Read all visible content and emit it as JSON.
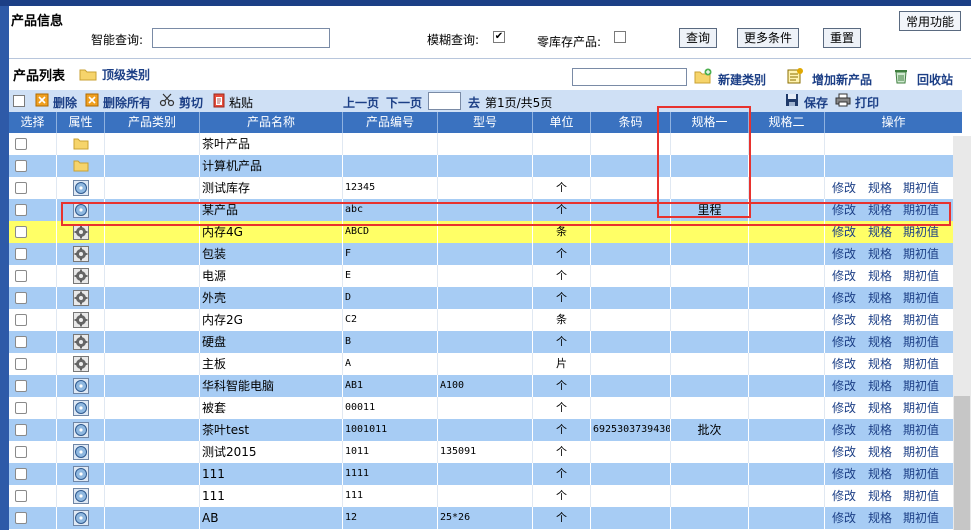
{
  "app": {
    "page_title": "产品信息",
    "common_functions": "常用功能"
  },
  "search": {
    "smart_label": "智能查询:",
    "smart_value": "",
    "fuzzy_label": "模糊查询:",
    "fuzzy_checked": "✔",
    "zero_stock_label": "零库存产品:",
    "query_button": "查询",
    "more_button": "更多条件",
    "reset_button": "重置"
  },
  "list": {
    "title": "产品列表",
    "top_category": "顶级类别",
    "new_category": "新建类别",
    "add_product": "增加新产品",
    "recycle_bin": "回收站",
    "search_value": ""
  },
  "toolbar": {
    "delete": "删除",
    "delete_all": "删除所有",
    "cut": "剪切",
    "paste": "粘贴",
    "prev_page": "上一页",
    "next_page": "下一页",
    "go_to": "去",
    "page_info": "第1页/共5页",
    "save": "保存",
    "print": "打印"
  },
  "table": {
    "headers": [
      "选择",
      "属性",
      "产品类别",
      "产品名称",
      "产品编号",
      "型号",
      "单位",
      "条码",
      "规格一",
      "规格二",
      "操作"
    ],
    "actions": {
      "edit": "修改",
      "spec": "规格",
      "initial": "期初值"
    },
    "rows": [
      {
        "type": "folder",
        "name": "茶叶产品",
        "code": "",
        "model": "",
        "unit": "",
        "barcode": "",
        "spec1": "",
        "spec2": "",
        "style": "white",
        "actions": false
      },
      {
        "type": "folder",
        "name": "计算机产品",
        "code": "",
        "model": "",
        "unit": "",
        "barcode": "",
        "spec1": "",
        "spec2": "",
        "style": "blue",
        "actions": false
      },
      {
        "type": "disc",
        "name": "测试库存",
        "code": "12345",
        "model": "",
        "unit": "个",
        "barcode": "",
        "spec1": "",
        "spec2": "",
        "style": "white",
        "actions": true
      },
      {
        "type": "disc",
        "name": "某产品",
        "code": "abc",
        "model": "",
        "unit": "个",
        "barcode": "",
        "spec1": "里程",
        "spec2": "",
        "style": "blue",
        "actions": true
      },
      {
        "type": "gear",
        "name": "内存4G",
        "code": "ABCD",
        "model": "",
        "unit": "条",
        "barcode": "",
        "spec1": "",
        "spec2": "",
        "style": "hl",
        "actions": true
      },
      {
        "type": "gear",
        "name": "包装",
        "code": "F",
        "model": "",
        "unit": "个",
        "barcode": "",
        "spec1": "",
        "spec2": "",
        "style": "blue",
        "actions": true
      },
      {
        "type": "gear",
        "name": "电源",
        "code": "E",
        "model": "",
        "unit": "个",
        "barcode": "",
        "spec1": "",
        "spec2": "",
        "style": "white",
        "actions": true
      },
      {
        "type": "gear",
        "name": "外壳",
        "code": "D",
        "model": "",
        "unit": "个",
        "barcode": "",
        "spec1": "",
        "spec2": "",
        "style": "blue",
        "actions": true
      },
      {
        "type": "gear",
        "name": "内存2G",
        "code": "C2",
        "model": "",
        "unit": "条",
        "barcode": "",
        "spec1": "",
        "spec2": "",
        "style": "white",
        "actions": true
      },
      {
        "type": "gear",
        "name": "硬盘",
        "code": "B",
        "model": "",
        "unit": "个",
        "barcode": "",
        "spec1": "",
        "spec2": "",
        "style": "blue",
        "actions": true
      },
      {
        "type": "gear",
        "name": "主板",
        "code": "A",
        "model": "",
        "unit": "片",
        "barcode": "",
        "spec1": "",
        "spec2": "",
        "style": "white",
        "actions": true
      },
      {
        "type": "disc",
        "name": "华科智能电脑",
        "code": "AB1",
        "model": "A100",
        "unit": "个",
        "barcode": "",
        "spec1": "",
        "spec2": "",
        "style": "blue",
        "actions": true
      },
      {
        "type": "disc",
        "name": "被套",
        "code": "00011",
        "model": "",
        "unit": "个",
        "barcode": "",
        "spec1": "",
        "spec2": "",
        "style": "white",
        "actions": true
      },
      {
        "type": "disc",
        "name": "茶叶test",
        "code": "1001011",
        "model": "",
        "unit": "个",
        "barcode": "6925303739430",
        "spec1": "批次",
        "spec2": "",
        "style": "blue",
        "actions": true
      },
      {
        "type": "disc",
        "name": "测试2015",
        "code": "1011",
        "model": "135091",
        "unit": "个",
        "barcode": "",
        "spec1": "",
        "spec2": "",
        "style": "white",
        "actions": true
      },
      {
        "type": "disc",
        "name": "111",
        "code": "1111",
        "model": "",
        "unit": "个",
        "barcode": "",
        "spec1": "",
        "spec2": "",
        "style": "blue",
        "actions": true
      },
      {
        "type": "disc",
        "name": "111",
        "code": "111",
        "model": "",
        "unit": "个",
        "barcode": "",
        "spec1": "",
        "spec2": "",
        "style": "white",
        "actions": true
      },
      {
        "type": "disc",
        "name": "AB",
        "code": "12",
        "model": "25*26",
        "unit": "个",
        "barcode": "",
        "spec1": "",
        "spec2": "",
        "style": "blue",
        "actions": true
      }
    ]
  },
  "colors": {
    "header_bg": "#3a72c0",
    "row_blue": "#a7ccf4",
    "row_highlight": "#ffff66",
    "annotation_red": "#e8322e",
    "link": "#1c3f86"
  }
}
